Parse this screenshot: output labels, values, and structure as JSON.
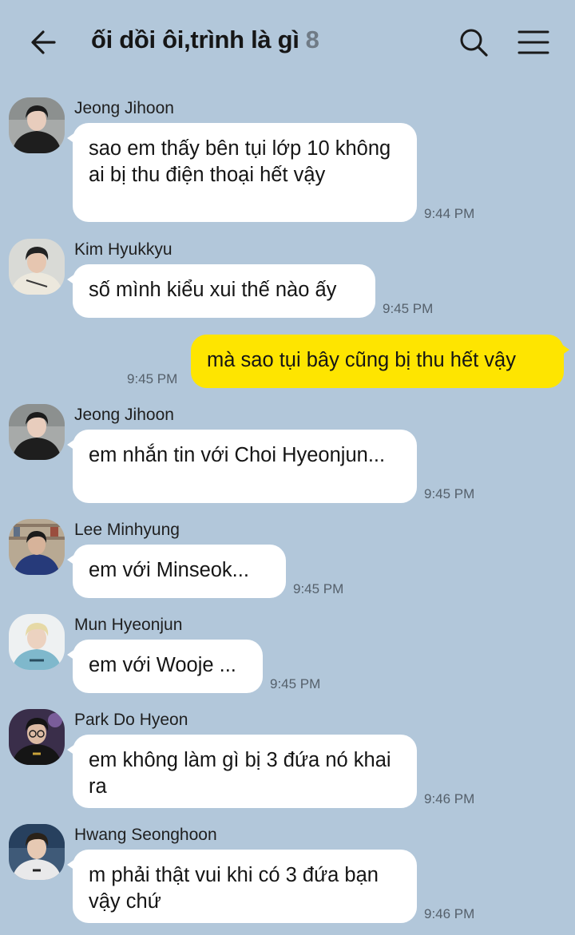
{
  "header": {
    "title": "ối dồi ôi,trình là gì",
    "member_count": "8",
    "back_icon": "back-arrow-icon",
    "search_icon": "search-icon",
    "menu_icon": "hamburger-menu-icon"
  },
  "colors": {
    "background": "#b2c7da",
    "incoming_bubble": "#ffffff",
    "outgoing_bubble": "#fee500"
  },
  "messages": [
    {
      "sender": "Jeong Jihoon",
      "text": "sao em thấy bên tụi lớp 10 không ai bị thu điện thoại hết vậy",
      "time": "9:44 PM",
      "direction": "incoming"
    },
    {
      "sender": "Kim Hyukkyu",
      "text": "số mình kiểu xui thế nào ấy",
      "time": "9:45 PM",
      "direction": "incoming"
    },
    {
      "sender": "",
      "text": "mà sao tụi bây cũng bị thu hết vậy",
      "time": "9:45 PM",
      "direction": "outgoing"
    },
    {
      "sender": "Jeong Jihoon",
      "text": "em nhắn tin với Choi Hyeonjun...",
      "time": "9:45 PM",
      "direction": "incoming"
    },
    {
      "sender": "Lee Minhyung",
      "text": "em với Minseok...",
      "time": "9:45 PM",
      "direction": "incoming"
    },
    {
      "sender": "Mun Hyeonjun",
      "text": "em với Wooje ...",
      "time": "9:45 PM",
      "direction": "incoming"
    },
    {
      "sender": "Park Do Hyeon",
      "text": "em không làm gì bị 3 đứa nó khai ra",
      "time": "9:46 PM",
      "direction": "incoming"
    },
    {
      "sender": "Hwang Seonghoon",
      "text": "m phải thật vui khi có 3 đứa bạn vậy chứ",
      "time": "9:46 PM",
      "direction": "incoming"
    }
  ]
}
